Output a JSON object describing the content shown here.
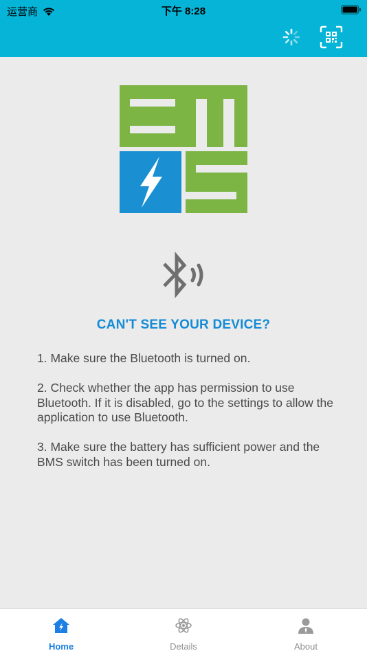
{
  "status_bar": {
    "carrier": "运营商",
    "time": "下午 8:28"
  },
  "header": {
    "loading_icon": "spinner-icon",
    "scan_icon": "qr-scan-icon"
  },
  "logo": {
    "text": "BMS",
    "colors": {
      "green": "#7cb544",
      "blue": "#1a90d3"
    }
  },
  "main": {
    "headline": "CAN'T SEE YOUR DEVICE?",
    "tips": [
      "1. Make sure the Bluetooth is turned on.",
      "2. Check whether the app has permission to use Bluetooth. If it is disabled, go to the settings to allow the application to use Bluetooth.",
      "3. Make sure the battery has sufficient power and the BMS switch has been turned on."
    ]
  },
  "tabbar": {
    "tabs": [
      {
        "label": "Home",
        "icon": "home-icon",
        "active": true
      },
      {
        "label": "Details",
        "icon": "atom-icon",
        "active": false
      },
      {
        "label": "About",
        "icon": "person-icon",
        "active": false
      }
    ]
  },
  "colors": {
    "header": "#05b4d6",
    "accent": "#1b7fe3",
    "headline": "#138bd6",
    "background": "#ebebeb"
  }
}
